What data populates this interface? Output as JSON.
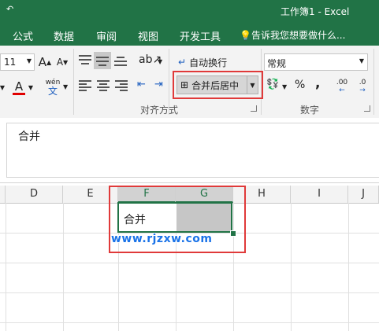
{
  "window": {
    "title": "工作簿1 - Excel",
    "quick_access": "↶"
  },
  "tabs": [
    "公式",
    "数据",
    "审阅",
    "视图",
    "开发工具"
  ],
  "tell_me": "告诉我您想要做什么...",
  "ribbon": {
    "font_size": "11",
    "grow_font": "A",
    "shrink_font": "A",
    "wen_label": "wén",
    "wen_char": "文",
    "wrap_text": "自动换行",
    "merge_center": "合并后居中",
    "number_format": "常规",
    "percent": "%",
    "comma": ",",
    "dec_inc": ".00",
    "dec_dec": ".0",
    "font_color_letter": "A",
    "group_alignment": "对齐方式",
    "group_number": "数字",
    "colors": {
      "accent": "#217346",
      "font_color_bar": "#e00000",
      "highlight": "#e03a3a"
    }
  },
  "formula_bar": {
    "content": "合并"
  },
  "columns": [
    "D",
    "E",
    "F",
    "G",
    "H",
    "I",
    "J"
  ],
  "cell_text": "合并",
  "watermark": "www.rjzxw.com"
}
